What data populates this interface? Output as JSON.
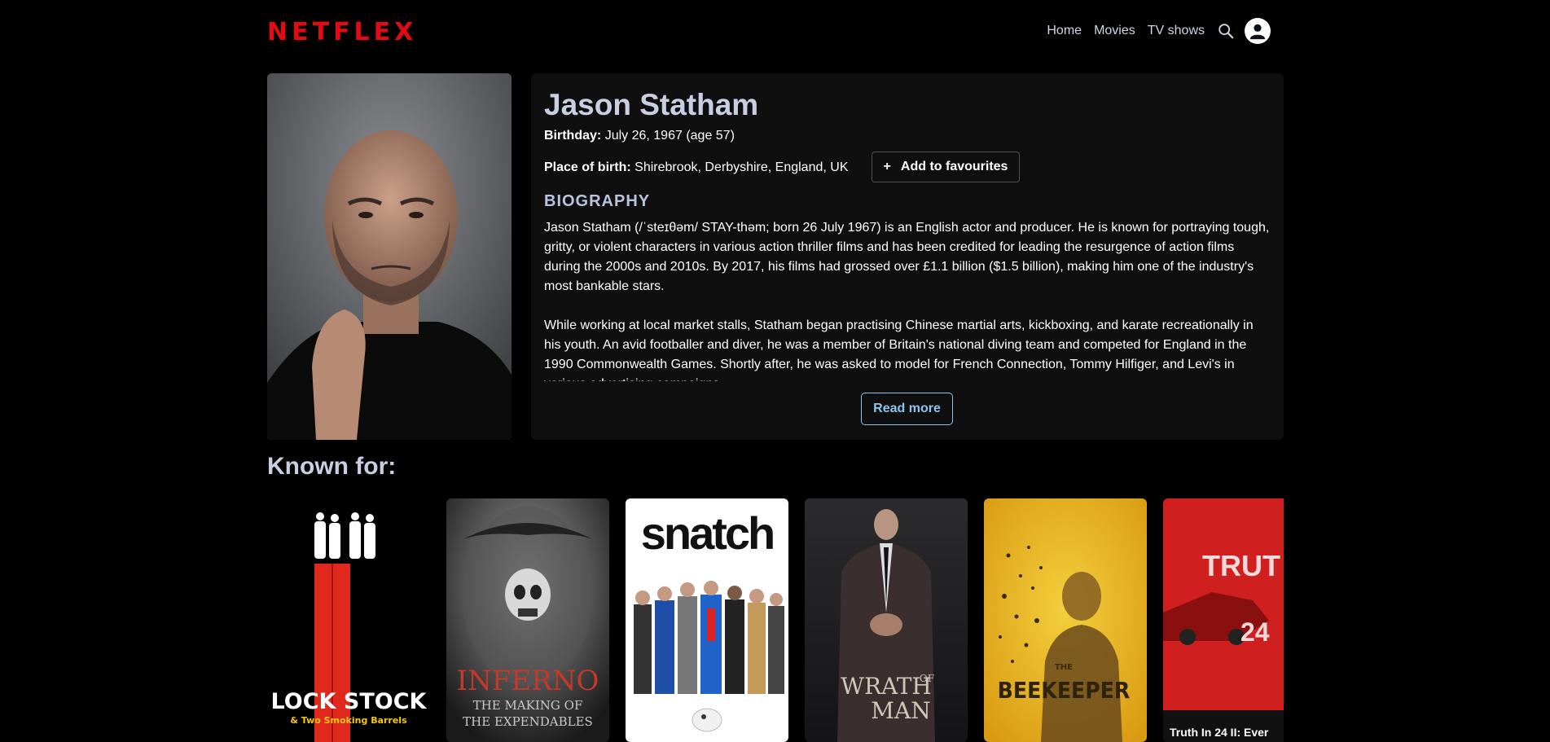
{
  "brand": "NETFLEX",
  "nav": {
    "home": "Home",
    "movies": "Movies",
    "tv": "TV shows"
  },
  "person": {
    "name": "Jason Statham",
    "birthday_label": "Birthday:",
    "birthday": "July 26, 1967 (age 57)",
    "birthplace_label": "Place of birth:",
    "birthplace": "Shirebrook, Derbyshire, England, UK",
    "fav_button": "Add to favourites",
    "bio_heading": "BIOGRAPHY",
    "bio_p1": "Jason Statham (/ˈsteɪθəm/ STAY-thəm; born 26 July 1967) is an English actor and producer. He is known for portraying tough, gritty, or violent characters in various action thriller films and has been credited for leading the resurgence of action films during the 2000s and 2010s. By 2017, his films had grossed over £1.1 billion ($1.5 billion), making him one of the industry's most bankable stars.",
    "bio_p2": "While working at local market stalls, Statham began practising Chinese martial arts, kickboxing, and karate recreationally in his youth. An avid footballer and diver, he was a member of Britain's national diving team and competed for England in the 1990 Commonwealth Games. Shortly after, he was asked to model for French Connection, Tommy Hilfiger, and Levi's in various advertising campaigns.",
    "read_more": "Read more"
  },
  "known_for": {
    "heading": "Known for:",
    "posters": [
      {
        "title_main": "LOCK STOCK",
        "title_sub": "& Two Smoking Barrels"
      },
      {
        "title_main": "INFERNO",
        "title_sub1": "THE MAKING OF",
        "title_sub2": "THE EXPENDABLES"
      },
      {
        "title_main": "snatch"
      },
      {
        "title_main1": "WRATH",
        "title_of": "OF",
        "title_main2": "MAN"
      },
      {
        "title_the": "THE",
        "title_main": "BEEKEEPER"
      },
      {
        "title_main": "TRUT",
        "title_num": "24",
        "caption": "Truth In 24 II: Ever"
      }
    ]
  },
  "colors": {
    "brand_red": "#e50914",
    "accent_blue": "#8fc4ec",
    "panel": "#0f0f10"
  }
}
